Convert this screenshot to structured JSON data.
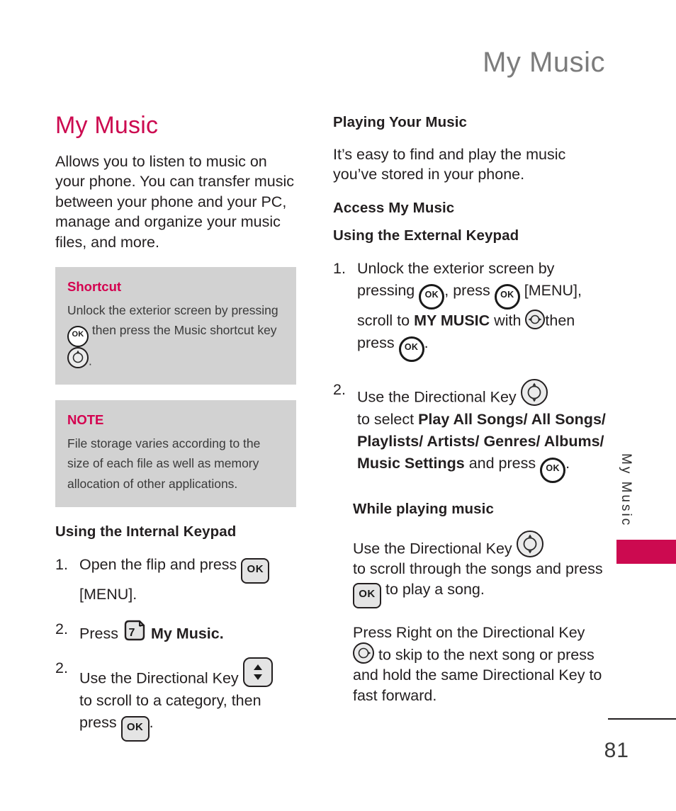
{
  "header": {
    "running_title": "My Music"
  },
  "left_column": {
    "section_title": "My Music",
    "intro": "Allows you to listen to music on your phone. You can transfer music between your phone and your PC, manage and organize your music files, and more.",
    "shortcut_box": {
      "label": "Shortcut",
      "text_part1": "Unlock the exterior screen by pressing",
      "key1": "OK",
      "text_part2": "then press the Music shortcut key",
      "key2": "directional-key",
      "text_part3": "."
    },
    "note_box": {
      "label": "NOTE",
      "text": "File storage varies according to the size of each file as well as memory allocation of other applications."
    },
    "internal_keypad_heading": "Using the Internal Keypad",
    "steps": [
      {
        "num": "1.",
        "part1": "Open the flip and press",
        "key": "OK",
        "part2": "[MENU]."
      },
      {
        "num": "2.",
        "part1": "Press",
        "key": "7",
        "key_sup": "*",
        "part2": "My Music."
      },
      {
        "num": "2.",
        "part1": "Use the Directional Key",
        "key": "up-down-key",
        "part2": "to scroll to a category, then press",
        "key2": "OK",
        "part3": "."
      }
    ]
  },
  "right_column": {
    "playing_heading": "Playing Your Music",
    "playing_text": "It’s easy to find and play the music you’ve stored in your phone.",
    "access_heading": "Access My Music",
    "external_keypad_heading": "Using the External Keypad",
    "steps": [
      {
        "num": "1.",
        "part1": "Unlock the exterior screen by pressing",
        "key1": "OK",
        "part2": ", press",
        "key2": "OK",
        "part3": "[MENU], scroll to",
        "bold1": "MY MUSIC",
        "part4": "with",
        "key3": "directional-key",
        "part5": "then press",
        "key4": "OK",
        "part6": "."
      },
      {
        "num": "2.",
        "part1": "Use the Directional Key",
        "key1": "directional-key",
        "part2": "to select",
        "bold1": "Play All Songs/ All Songs/ Playlists/ Artists/ Genres/ Albums/ Music Settings",
        "part3": "and press",
        "key2": "OK",
        "part4": "."
      }
    ],
    "while_playing_heading": "While playing music",
    "while_playing": {
      "part1": "Use the Directional Key",
      "key1": "directional-key",
      "part2": "to scroll through the songs and press",
      "key2": "OK",
      "part3": "to play a song."
    },
    "fast_forward": {
      "part1": "Press Right on the Directional Key",
      "key1": "directional-key-right",
      "part2": "to skip to the next song or press and hold the same Directional Key to fast forward."
    }
  },
  "side_tab": {
    "label": "My Music",
    "accent_color": "#cc0a50"
  },
  "footer": {
    "page_number": "81"
  }
}
